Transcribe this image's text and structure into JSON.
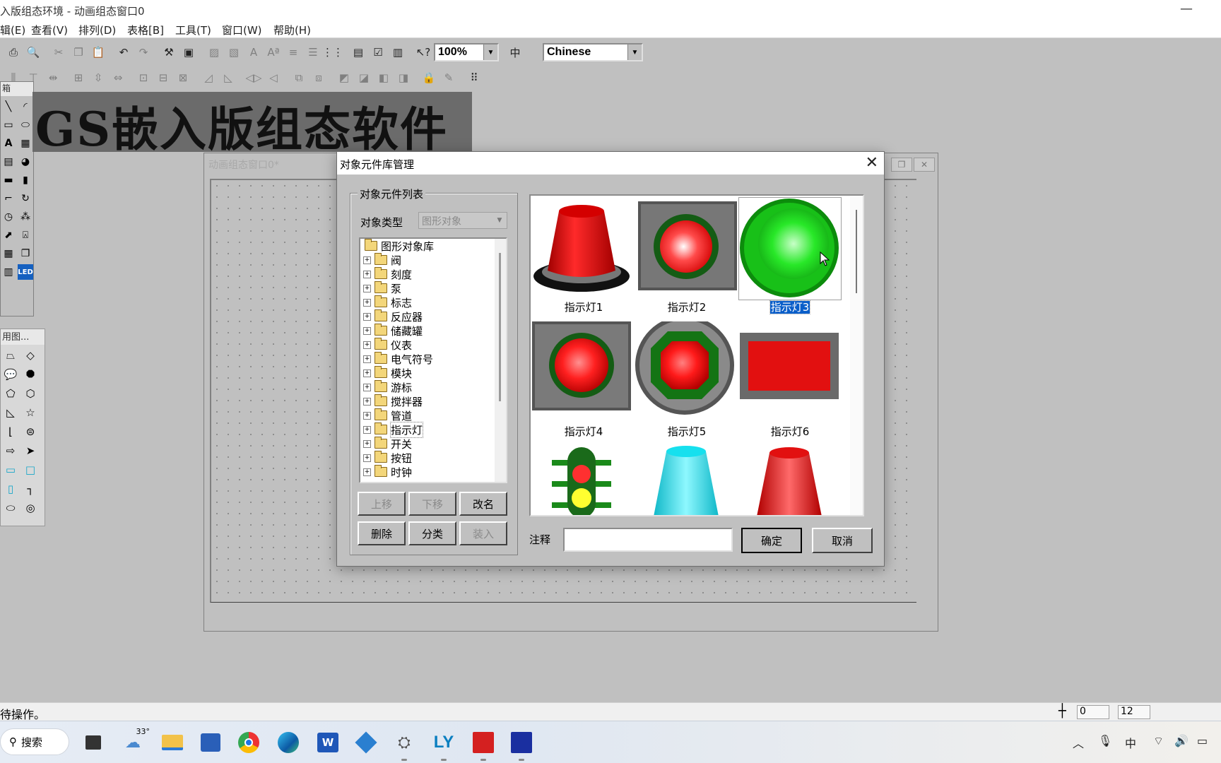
{
  "app": {
    "title": "入版组态环境 - 动画组态窗口0",
    "minimize": "—"
  },
  "menu": [
    {
      "label": "辑(E)"
    },
    {
      "label": "查看(V)"
    },
    {
      "label": "排列(D)"
    },
    {
      "label": "表格[B]"
    },
    {
      "label": "工具(T)"
    },
    {
      "label": "窗口(W)"
    },
    {
      "label": "帮助(H)"
    }
  ],
  "toolbar": {
    "zoom_value": "100%",
    "language_value": "Chinese"
  },
  "palette1": {
    "header": "箱"
  },
  "palette2": {
    "header": "用图..."
  },
  "banner": {
    "text": "GS嵌入版组态软件"
  },
  "anim_window": {
    "title": "动画组态窗口0*"
  },
  "dialog": {
    "title": "对象元件库管理",
    "close": "✕",
    "group_label": "对象元件列表",
    "type_label": "对象类型",
    "type_value": "图形对象",
    "tree_root": "图形对象库",
    "tree_items": [
      "阀",
      "刻度",
      "泵",
      "标志",
      "反应器",
      "储藏罐",
      "仪表",
      "电气符号",
      "模块",
      "游标",
      "搅拌器",
      "管道",
      "指示灯",
      "开关",
      "按钮",
      "时钟"
    ],
    "buttons": {
      "up": "上移",
      "down": "下移",
      "rename": "改名",
      "delete": "删除",
      "classify": "分类",
      "load": "装入",
      "ok": "确定",
      "cancel": "取消"
    },
    "note_label": "注释",
    "note_value": "",
    "items": [
      {
        "label": "指示灯1"
      },
      {
        "label": "指示灯2"
      },
      {
        "label": "指示灯3",
        "selected": true
      },
      {
        "label": "指示灯4"
      },
      {
        "label": "指示灯5"
      },
      {
        "label": "指示灯6"
      }
    ]
  },
  "statusbar": {
    "text": "待操作。",
    "x": "0",
    "y": "12"
  },
  "taskbar": {
    "search": "搜索",
    "weather_temp": "33°",
    "ly_label": "LY",
    "ime": "中"
  },
  "colors": {
    "red_lamp": "#e21010",
    "green_lamp": "#18d418",
    "selection": "#0a5ec9",
    "cyan_lamp": "#16e0ee"
  }
}
